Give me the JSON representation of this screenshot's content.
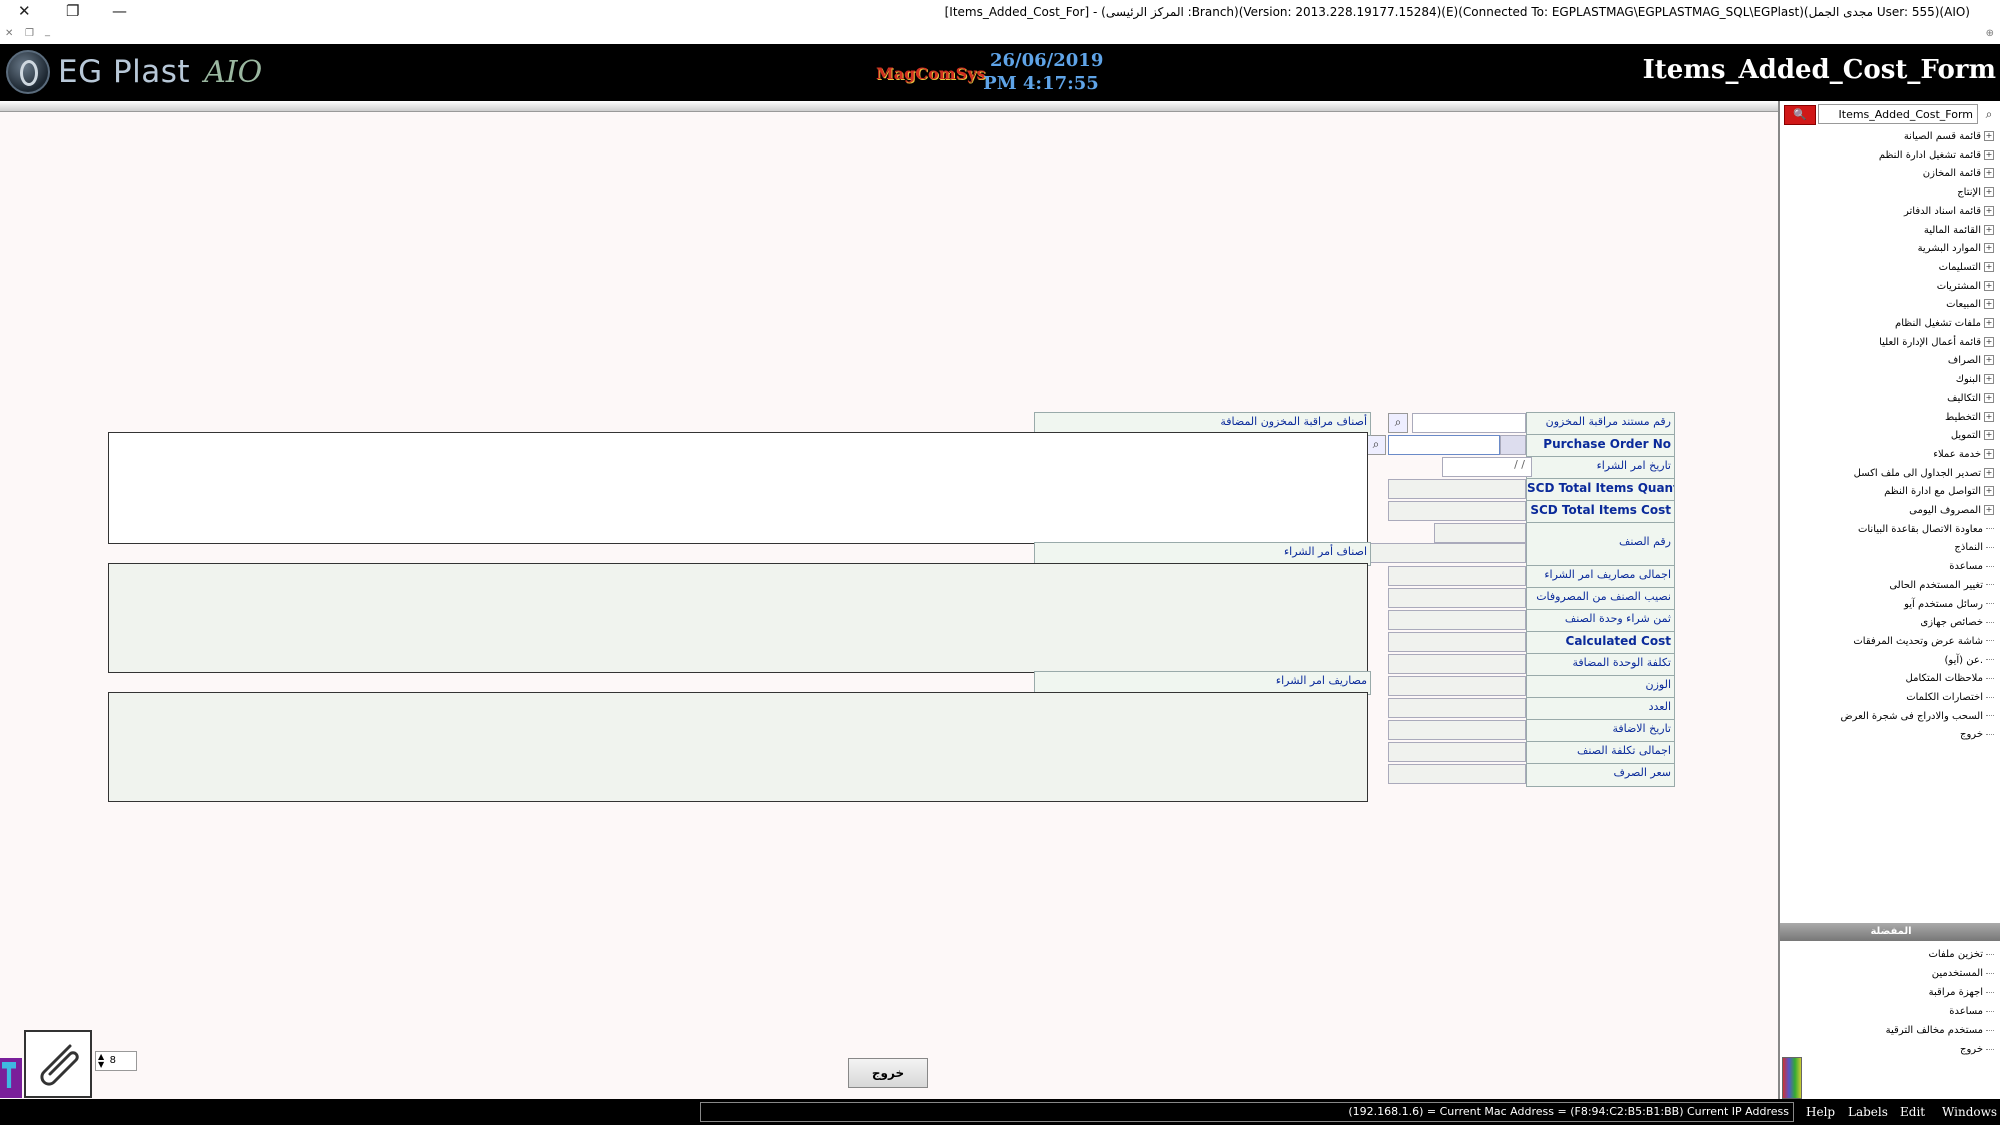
{
  "window": {
    "title": "[Items_Added_Cost_For] - (المركز الرئيسى :Branch)(Version: 2013.228.19177.15284)(E)(Connected To: EGPLASTMAG\\EGPLASTMAG_SQL\\EGPlast)(مجدى الجمل User: 555)(AIO)",
    "close_glyph": "✕",
    "restore_glyph": "❐",
    "minimize_glyph": "—",
    "mdi_close": "✕",
    "mdi_restore": "❐",
    "mdi_min": "_",
    "mdi_right": "⊕"
  },
  "header": {
    "logo_text": "EG Plast",
    "logo_suffix": "AIO",
    "brand": "MagComSys",
    "date": "26/06/2019",
    "time": "PM 4:17:55",
    "form_title": "Items_Added_Cost_Form"
  },
  "form": {
    "labels": {
      "stock_doc_no": "رقم مستند مراقبة المخزون",
      "purchase_order_no": "Purchase Order No",
      "purchase_order_date": "تاريخ امر الشراء",
      "scd_total_qty": "SCD Total Items Quantity",
      "scd_total_cost": "SCD Total Items Cost",
      "item_no": "رقم الصنف",
      "po_total_expenses": "اجمالى مصاريف امر الشراء",
      "item_share_expenses": "نصيب الصنف من المصروفات",
      "item_unit_price": "ثمن شراء وحدة الصنف",
      "calculated_cost": "Calculated Cost",
      "added_unit_cost": "تكلفة الوحدة المضافة",
      "weight": "الوزن",
      "count": "العدد",
      "added_date": "تاريخ الاضافة",
      "item_total_cost": "اجمالى تكلفة الصنف",
      "exchange_rate": "سعر الصرف"
    },
    "date_placeholder": " /  /",
    "grids": {
      "stock_items_title": "أصناف مراقبة المخزون المضافة",
      "po_items_title": "اصناف أمر الشراء",
      "po_expenses_title": "مصاريف امر الشراء"
    },
    "exit_button": "خروج",
    "page_spinner": "8",
    "search_glyph": "⌕"
  },
  "sidebar": {
    "search_value": "Items_Added_Cost_Form",
    "search_button": "🔍",
    "tree_items": [
      {
        "label": "قائمة قسم الصيانة",
        "expandable": true
      },
      {
        "label": "قائمة تشغيل ادارة النظم",
        "expandable": true
      },
      {
        "label": "قائمة المخازن",
        "expandable": true
      },
      {
        "label": "الإنتاج",
        "expandable": true
      },
      {
        "label": "قائمة اسناد الدفاتر",
        "expandable": true
      },
      {
        "label": "القائمة المالية",
        "expandable": true
      },
      {
        "label": "الموارد البشرية",
        "expandable": true
      },
      {
        "label": "التسليمات",
        "expandable": true
      },
      {
        "label": "المشتريات",
        "expandable": true
      },
      {
        "label": "المبيعات",
        "expandable": true
      },
      {
        "label": "ملفات تشغيل النظام",
        "expandable": true
      },
      {
        "label": "قائمة أعمال الإدارة العليا",
        "expandable": true
      },
      {
        "label": "الصراف",
        "expandable": true
      },
      {
        "label": "البنوك",
        "expandable": true
      },
      {
        "label": "التكاليف",
        "expandable": true
      },
      {
        "label": "التخطيط",
        "expandable": true
      },
      {
        "label": "التمويل",
        "expandable": true
      },
      {
        "label": "خدمة عملاء",
        "expandable": true
      },
      {
        "label": "تصدير الجداول الى ملف اكسل",
        "expandable": true
      },
      {
        "label": "التواصل مع ادارة النظم",
        "expandable": true
      },
      {
        "label": "المصروف اليومى",
        "expandable": true
      },
      {
        "label": "معاودة الاتصال بقاعدة البيانات",
        "expandable": false
      },
      {
        "label": "النماذج",
        "expandable": false
      },
      {
        "label": "مساعدة",
        "expandable": false
      },
      {
        "label": "تغيير المستخدم الحالى",
        "expandable": false
      },
      {
        "label": "رسائل مستخدم آيو",
        "expandable": false
      },
      {
        "label": "خصائص جهازى",
        "expandable": false
      },
      {
        "label": "شاشة عرض وتحديث المرفقات",
        "expandable": false
      },
      {
        "label": "عن (آيو).",
        "expandable": false
      },
      {
        "label": "ملاحظات المتكامل",
        "expandable": false
      },
      {
        "label": "اختصارات الكلمات",
        "expandable": false
      },
      {
        "label": "السحب والادراج فى شجرة العرض",
        "expandable": false
      },
      {
        "label": "خروج",
        "expandable": false
      }
    ],
    "section_title": "المفضلة",
    "favorites": [
      {
        "label": "تخزين ملفات"
      },
      {
        "label": "المستخدمين"
      },
      {
        "label": "اجهزة مراقبة"
      },
      {
        "label": "مساعدة"
      },
      {
        "label": "مستخدم مخالف الترقية"
      },
      {
        "label": "خروج"
      }
    ]
  },
  "statusbar": {
    "text": "(192.168.1.6) = Current Mac Address = (F8:94:C2:B5:B1:BB) Current IP Address",
    "menu": [
      "Help",
      "Labels",
      "Edit",
      "Windows"
    ]
  },
  "colors": {
    "label_text": "#0a2a9a",
    "header_date": "#5fa4e8",
    "accent_red": "#d01818"
  }
}
